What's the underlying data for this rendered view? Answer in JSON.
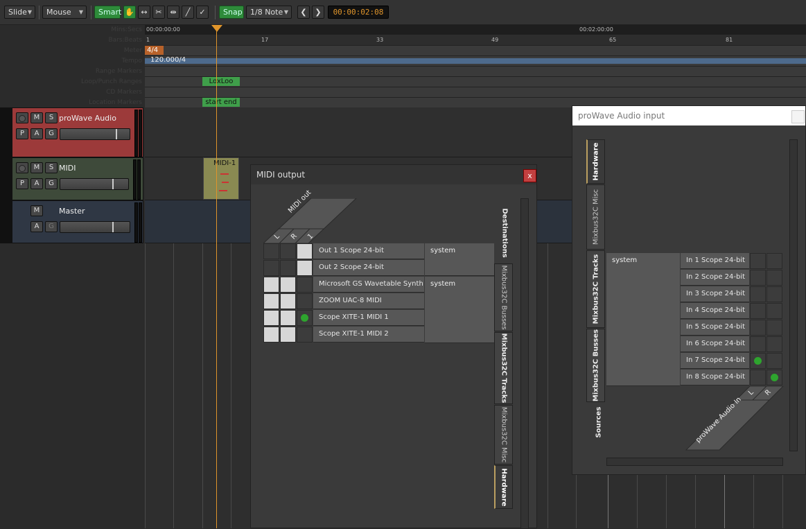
{
  "toolbar": {
    "edit_mode": "Slide",
    "mouse_mode": "Mouse",
    "smart": "Smart",
    "snap": "Snap",
    "grid": "1/8 Note",
    "clock": "00:00:02:08",
    "icons": [
      "grab-icon",
      "range-icon",
      "cut-icon",
      "stretch-icon",
      "draw-icon",
      "audition-icon"
    ]
  },
  "ruler": {
    "labels": [
      "Mins:Secs",
      "Bars:Beats",
      "Meter",
      "Tempo",
      "Range Markers",
      "Loop/Punch Ranges",
      "CD Markers",
      "Location Markers"
    ],
    "minsecs": [
      "00:00:00:00",
      "00:02:00:00"
    ],
    "bars": [
      "1",
      "17",
      "33",
      "49",
      "65",
      "81"
    ],
    "meter": "4/4",
    "tempo": "120.000/4",
    "loop_marker": "LoxLoo",
    "location_marker": "start end",
    "playhead_pct": 0.11
  },
  "tracks": [
    {
      "name": "proWave Audio",
      "buttons": [
        "M",
        "S",
        "P",
        "A",
        "G"
      ],
      "gain": 0.83
    },
    {
      "name": "MIDI",
      "buttons": [
        "M",
        "S",
        "P",
        "A",
        "G"
      ],
      "gain": 0.8,
      "region": "MIDI-1"
    },
    {
      "name": "Master",
      "buttons": [
        "M",
        "A",
        "G"
      ],
      "gain": 0.78
    }
  ],
  "midi_output": {
    "title": "MIDI output",
    "close": "x",
    "column_header": "MIDI out",
    "column_ports": [
      "L",
      "R",
      "1"
    ],
    "rows": [
      {
        "port": "Out 1 Scope 24-bit",
        "cells": [
          "dark",
          "dark",
          "light"
        ],
        "dot": -1
      },
      {
        "port": "Out 2 Scope 24-bit",
        "cells": [
          "dark",
          "dark",
          "light"
        ],
        "dot": -1
      },
      {
        "port": "Microsoft GS Wavetable Synth",
        "cells": [
          "light",
          "light",
          "dark"
        ],
        "dot": -1
      },
      {
        "port": "ZOOM UAC-8 MIDI",
        "cells": [
          "light",
          "light",
          "dark"
        ],
        "dot": -1
      },
      {
        "port": "Scope XITE-1 MIDI 1",
        "cells": [
          "light",
          "light",
          "dark"
        ],
        "dot": 2
      },
      {
        "port": "Scope XITE-1 MIDI 2",
        "cells": [
          "light",
          "light",
          "dark"
        ],
        "dot": -1
      }
    ],
    "groups": [
      "system",
      "system"
    ],
    "destinations_label": "Destinations",
    "tabs": [
      "Mixbus32C Busses",
      "Mixbus32C Tracks",
      "Mixbus32C Misc",
      "Hardware"
    ]
  },
  "audio_input": {
    "title": "proWave Audio input",
    "group": "system",
    "rows": [
      {
        "port": "In 1 Scope 24-bit",
        "dot": -1
      },
      {
        "port": "In 2 Scope 24-bit",
        "dot": -1
      },
      {
        "port": "In 3 Scope 24-bit",
        "dot": -1
      },
      {
        "port": "In 4 Scope 24-bit",
        "dot": -1
      },
      {
        "port": "In 5 Scope 24-bit",
        "dot": -1
      },
      {
        "port": "In 6 Scope 24-bit",
        "dot": -1
      },
      {
        "port": "In 7 Scope 24-bit",
        "dot": 0
      },
      {
        "port": "In 8 Scope 24-bit",
        "dot": 1
      }
    ],
    "column_header": "proWave Audio In",
    "column_ports": [
      "L",
      "R"
    ],
    "sources_label": "Sources",
    "tabs": [
      "Hardware",
      "Mixbus32C Misc",
      "Mixbus32C Tracks",
      "Mixbus32C Busses"
    ]
  },
  "colors": {
    "accent_green": "#2e8b3a",
    "audio_track": "#9c3a3a",
    "midi_track": "#3e4a3a",
    "master_track": "#2f3744",
    "clock": "#e0952b"
  }
}
